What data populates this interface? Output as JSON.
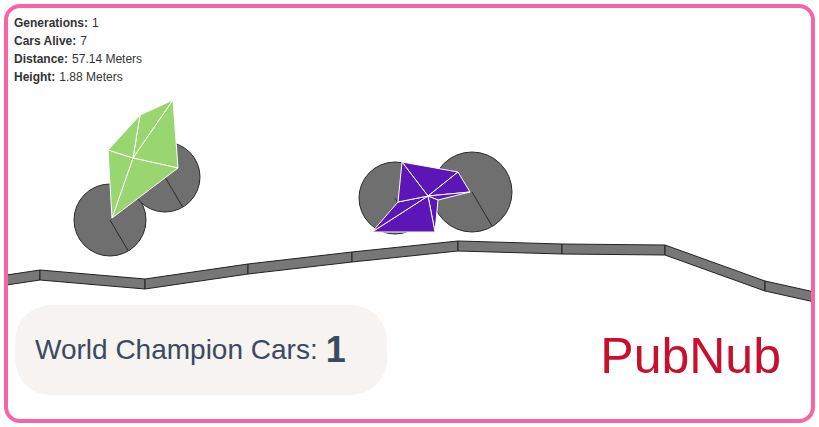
{
  "stats": [
    {
      "label": "Generations:",
      "value": "1"
    },
    {
      "label": "Cars Alive:",
      "value": "7"
    },
    {
      "label": "Distance:",
      "value": "57.14 Meters"
    },
    {
      "label": "Height:",
      "value": "1.88 Meters"
    }
  ],
  "cars": [
    {
      "name": "green-car",
      "color": "#9ad66f"
    },
    {
      "name": "purple-car",
      "color": "#5c16b8"
    }
  ],
  "champion": {
    "label": "World Champion Cars:",
    "count": "1"
  },
  "logo": "PubNub"
}
